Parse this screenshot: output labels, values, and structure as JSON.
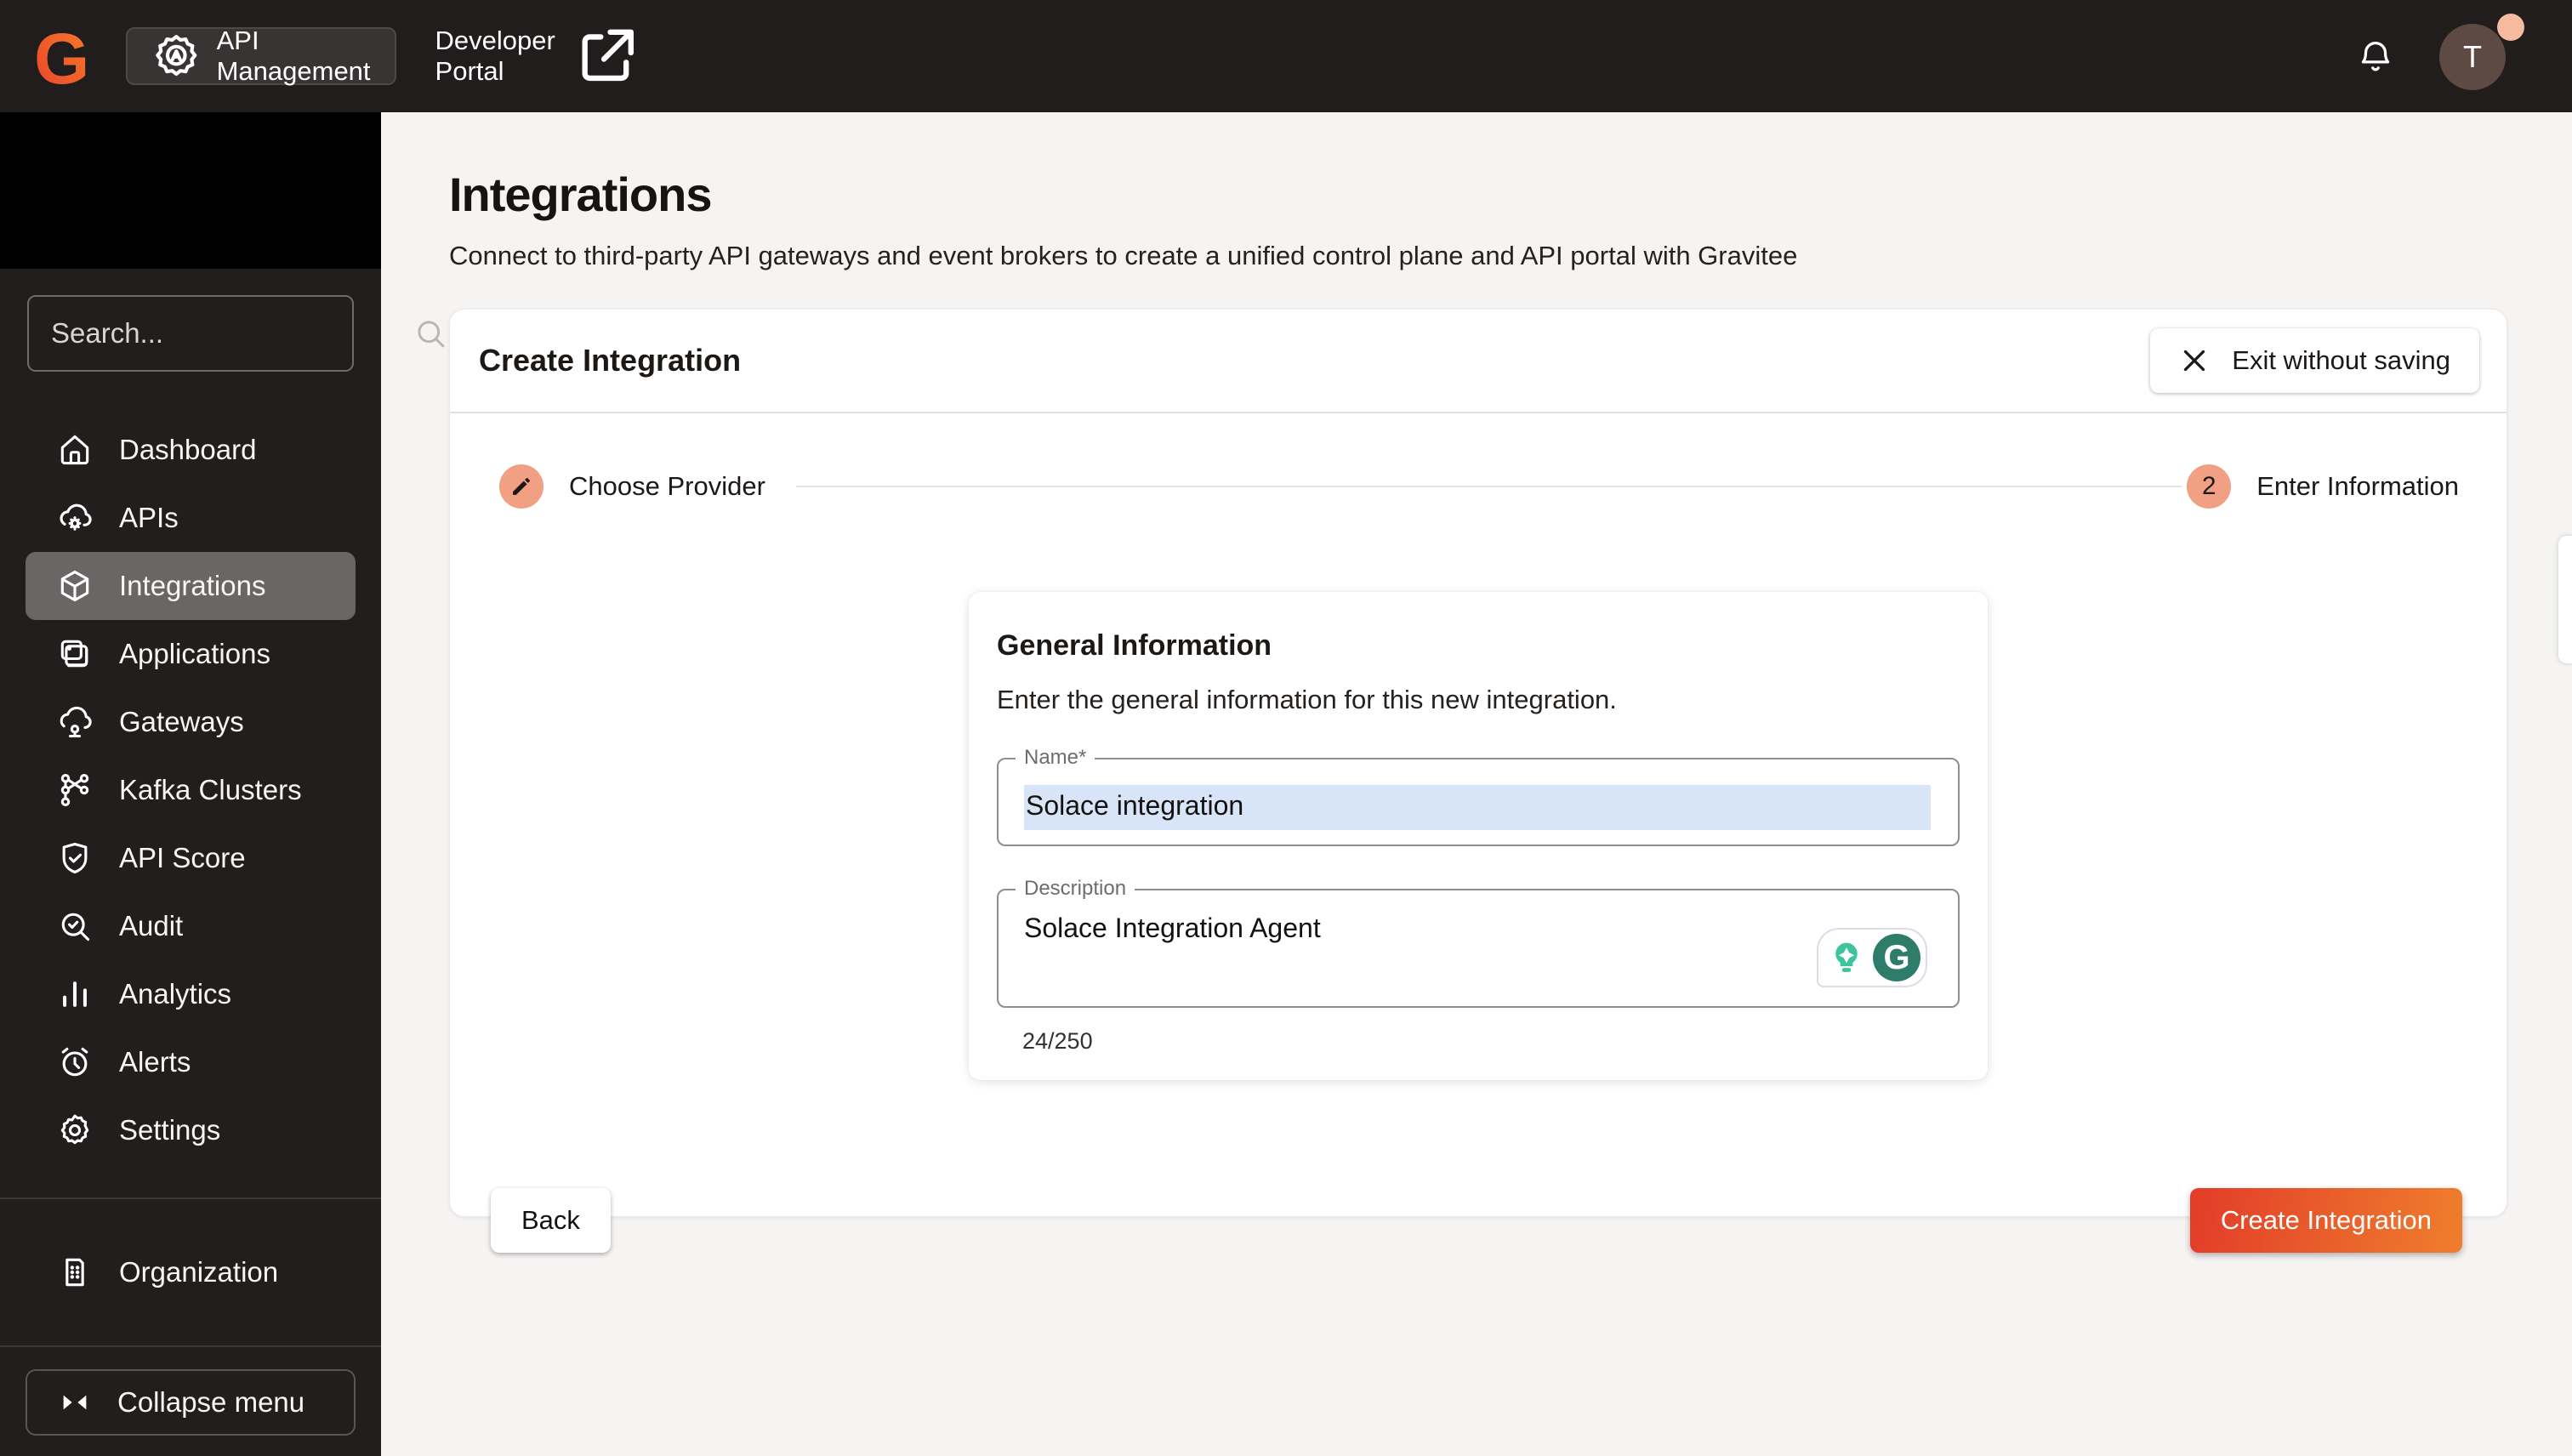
{
  "topbar": {
    "app_switcher_label": "API Management",
    "app_switcher_icon": "gear-badge-icon",
    "developer_portal_label": "Developer Portal",
    "developer_portal_icon": "external-link-icon",
    "notifications_icon": "bell-icon",
    "avatar_initial": "T",
    "brand_color_start": "#f04a2f",
    "brand_color_end": "#fa7d28"
  },
  "sidebar": {
    "search_placeholder": "Search...",
    "search_icon": "search-icon",
    "items": [
      {
        "label": "Dashboard",
        "icon": "home-icon",
        "selected": false
      },
      {
        "label": "APIs",
        "icon": "cloud-gear-icon",
        "selected": false
      },
      {
        "label": "Integrations",
        "icon": "cube-icon",
        "selected": true
      },
      {
        "label": "Applications",
        "icon": "apps-icon",
        "selected": false
      },
      {
        "label": "Gateways",
        "icon": "cloud-node-icon",
        "selected": false
      },
      {
        "label": "Kafka Clusters",
        "icon": "network-nodes-icon",
        "selected": false
      },
      {
        "label": "API Score",
        "icon": "shield-check-icon",
        "selected": false
      },
      {
        "label": "Audit",
        "icon": "search-check-icon",
        "selected": false
      },
      {
        "label": "Analytics",
        "icon": "bar-chart-icon",
        "selected": false
      },
      {
        "label": "Alerts",
        "icon": "alarm-clock-icon",
        "selected": false
      },
      {
        "label": "Settings",
        "icon": "gear-icon",
        "selected": false
      }
    ],
    "organization_label": "Organization",
    "organization_icon": "org-card-icon",
    "collapse_label": "Collapse menu",
    "collapse_icon": "collapse-arrows-icon"
  },
  "page": {
    "title": "Integrations",
    "subtitle": "Connect to third-party API gateways and event brokers to create a unified control plane and API portal with Gravitee"
  },
  "wizard": {
    "title": "Create Integration",
    "exit_label": "Exit without saving",
    "exit_icon": "close-icon",
    "steps": [
      {
        "label": "Choose Provider",
        "icon": "pencil-icon",
        "state": "completed-editing"
      },
      {
        "number": "2",
        "label": "Enter Information",
        "state": "current"
      }
    ],
    "step_accent_color": "#f2a083",
    "form": {
      "heading": "General Information",
      "description": "Enter the general information for this new integration.",
      "name_label": "Name*",
      "name_value": "Solace integration",
      "name_selection_color": "#d8e5f8",
      "description_label": "Description",
      "description_value": "Solace Integration Agent",
      "char_counter": "24/250",
      "grammarly_icons": [
        "lightbulb-suggestion-icon",
        "grammarly-g-icon"
      ]
    },
    "back_label": "Back",
    "submit_label": "Create Integration",
    "submit_gradient": [
      "#e23c29",
      "#ef7e2d"
    ]
  }
}
